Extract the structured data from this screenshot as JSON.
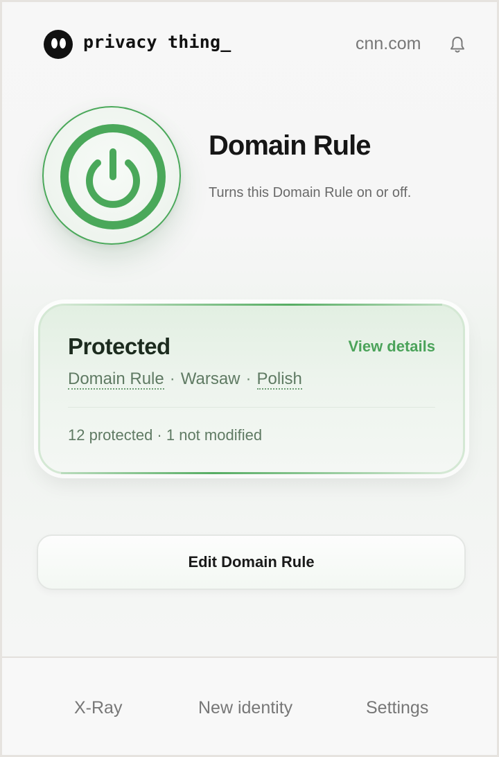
{
  "header": {
    "brand": "privacy thing_",
    "domain": "cnn.com",
    "icons": {
      "logo": "eyes-logo-icon",
      "notifications": "bell-icon"
    }
  },
  "hero": {
    "title": "Domain Rule",
    "description": "Turns this Domain Rule on or off.",
    "power_state": "on",
    "power_icon": "power-icon"
  },
  "card": {
    "title": "Protected",
    "view_details": "View details",
    "meta": {
      "rule": "Domain Rule",
      "separator": "·",
      "city": "Warsaw",
      "language": "Polish"
    },
    "stats": "12 protected · 1 not modified"
  },
  "actions": {
    "edit_label": "Edit Domain Rule"
  },
  "footer": {
    "items": [
      {
        "label": "X-Ray"
      },
      {
        "label": "New identity"
      },
      {
        "label": "Settings"
      }
    ]
  },
  "colors": {
    "accent_green": "#4aa85a",
    "text_dark": "#161616",
    "text_muted": "#777777"
  }
}
